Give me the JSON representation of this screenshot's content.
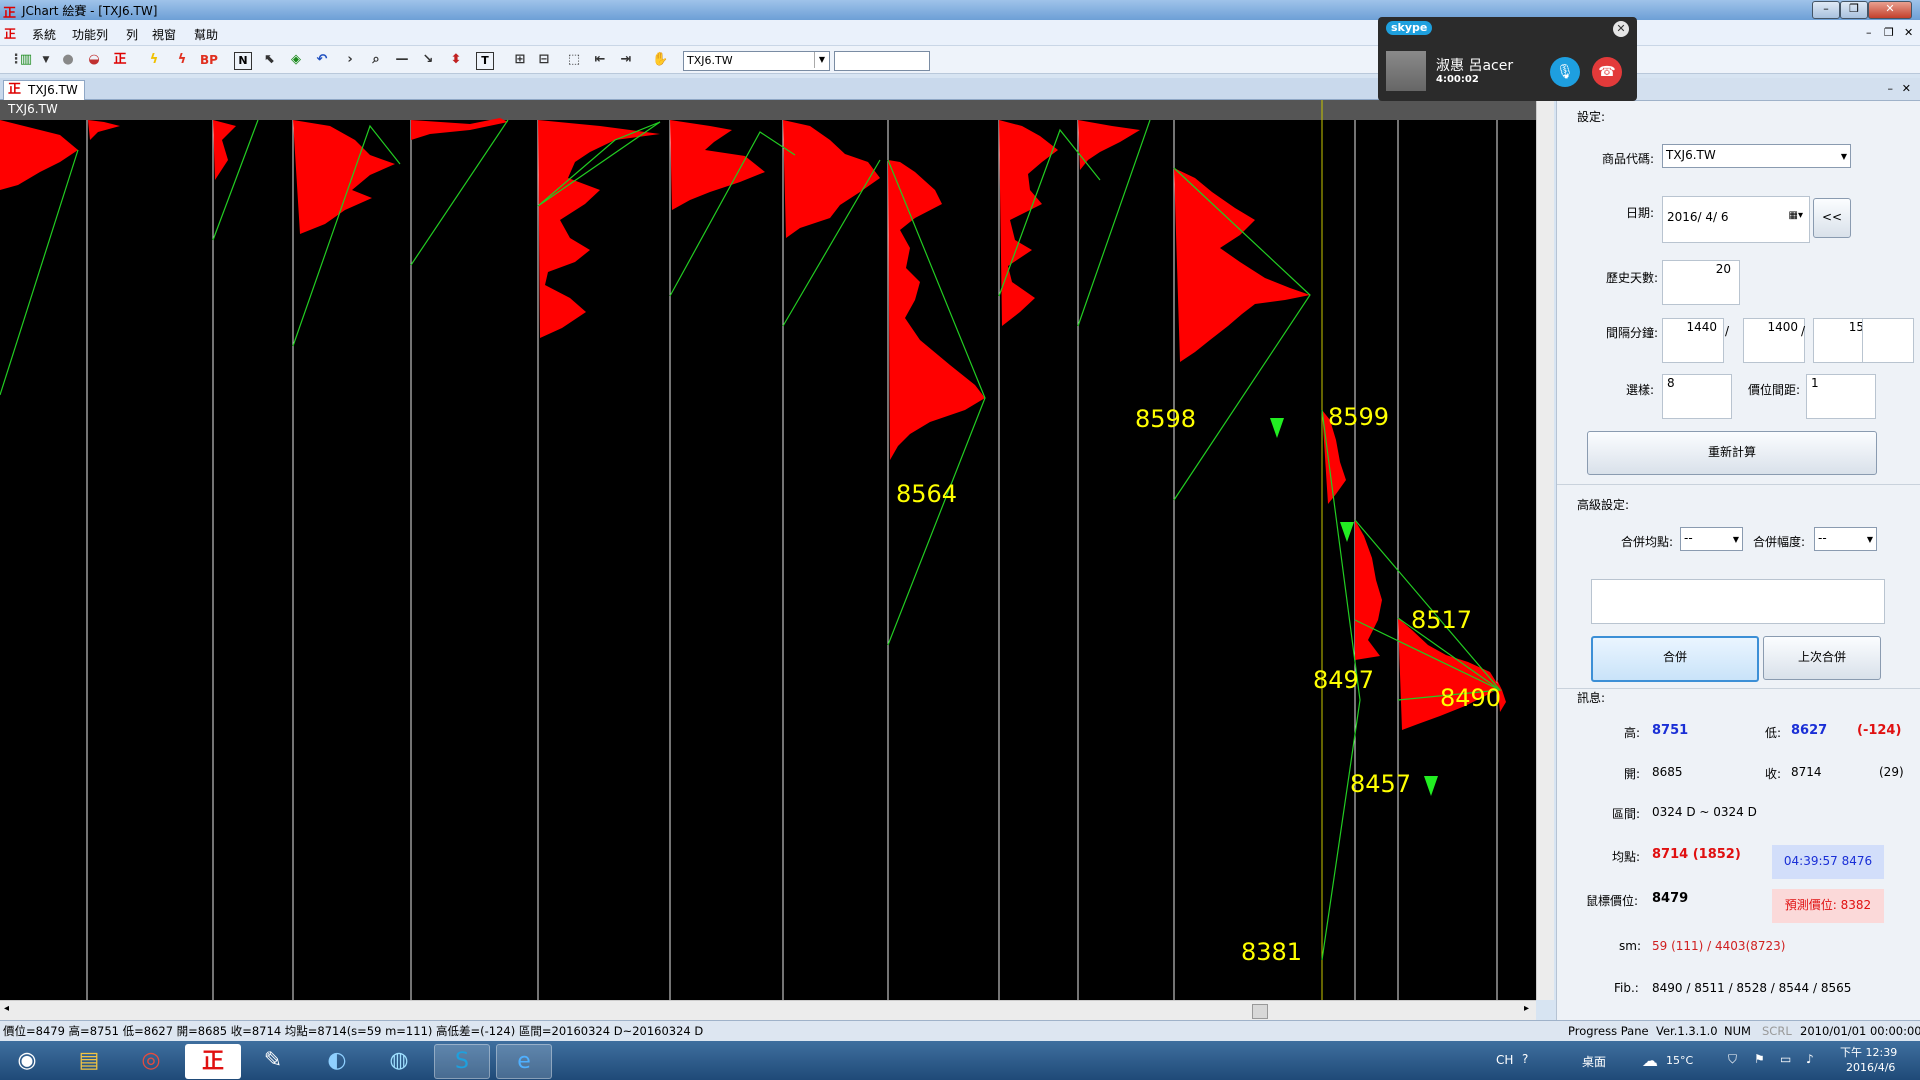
{
  "window": {
    "title": "JChart 絵賽 - [TXJ6.TW]",
    "buttons": [
      "–",
      "❐",
      "✕"
    ],
    "inner_buttons": [
      "–",
      "❐",
      "✕"
    ]
  },
  "menu": [
    "系統",
    "功能列",
    "列",
    "視窗",
    "幫助"
  ],
  "toolbar": {
    "symbol_combo": "TXJ6.TW",
    "icons": [
      "chart-icon",
      "circle-icon",
      "stop-icon",
      "logo-icon",
      "lightning-icon",
      "lightning2-icon",
      "bp-icon",
      "n-icon",
      "cursor-icon",
      "cube-icon",
      "undo-icon",
      "arrow-icon",
      "zoom-icon",
      "hline-icon",
      "diag-icon",
      "move-icon",
      "text-icon",
      "plus-icon",
      "minus-icon",
      "select-icon",
      "back-icon",
      "fwd-icon",
      "hand-icon"
    ],
    "bp_label": "BP",
    "n_label": "N",
    "t_label": "T"
  },
  "tab": {
    "label": "TXJ6.TW"
  },
  "chart": {
    "header": "TXJ6.TW",
    "price_labels": [
      {
        "text": "8598"
      },
      {
        "text": "8599"
      },
      {
        "text": "8564"
      },
      {
        "text": "8517"
      },
      {
        "text": "8497"
      },
      {
        "text": "8490"
      },
      {
        "text": "8457"
      },
      {
        "text": "8381"
      }
    ],
    "colors": {
      "profile": "#ff0000",
      "trend_line": "#22cc22",
      "label": "#ffff00",
      "cursor": "#cccc00"
    }
  },
  "statusbar": {
    "info": "價位=8479 高=8751 低=8627 開=8685 收=8714 均點=8714(s=59 m=111) 高低差=(-124) 區間=20160324 D~20160324 D",
    "progress": "Progress Pane",
    "version": "Ver.1.3.1.0",
    "num": "NUM",
    "scrl": "SCRL",
    "datetime": "2010/01/01 00:00:00"
  },
  "panel": {
    "settings_title": "設定:",
    "symbol_label": "商品代碼:",
    "symbol_value": "TXJ6.TW",
    "date_label": "日期:",
    "date_value": "2016/ 4/ 6",
    "date_btn": "<<",
    "history_label": "歷史天數:",
    "history_value": "20",
    "interval_label": "間隔分鐘:",
    "interval_1": "1440",
    "interval_2": "1400",
    "interval_3": "15",
    "interval_sep": "/",
    "samples_label": "選樣:",
    "samples_value": "8",
    "price_gap_label": "價位間距:",
    "price_gap_value": "1",
    "recalc_btn": "重新計算",
    "advanced_title": "高級設定:",
    "merge_avg_label": "合併均點:",
    "merge_avg_value": "--",
    "merge_range_label": "合併幅度:",
    "merge_range_value": "--",
    "merge_btn": "合併",
    "last_merge_btn": "上次合併",
    "info_title": "訊息:",
    "high_label": "高:",
    "high_value": "8751",
    "low_label": "低:",
    "low_value": "8627",
    "diff_value": "(-124)",
    "open_label": "開:",
    "open_value": "8685",
    "close_label": "收:",
    "close_value": "8714",
    "close_extra": "(29)",
    "range_label": "區間:",
    "range_value": "0324 D ~ 0324 D",
    "avg_label": "均點:",
    "avg_value": "8714 (1852)",
    "time_box": "04:39:57  8476",
    "mouse_label": "鼠標價位:",
    "mouse_value": "8479",
    "predict_box": "預測價位: 8382",
    "sm_label": "sm:",
    "sm_value": "59 (111) / 4403(8723)",
    "fib_label": "Fib.:",
    "fib_value": "8490 / 8511 / 8528 / 8544 / 8565"
  },
  "skype": {
    "logo": "skype",
    "name": "淑惠 呂acer",
    "time": "4:00:02"
  },
  "taskbar": {
    "items": [
      "start-orb",
      "explorer",
      "chrome",
      "jchart",
      "pen",
      "edge",
      "app",
      "skype",
      "ie"
    ],
    "lang": "CH",
    "desktop": "桌面",
    "temp": "15°C",
    "time": "下午 12:39",
    "date": "2016/4/6"
  }
}
